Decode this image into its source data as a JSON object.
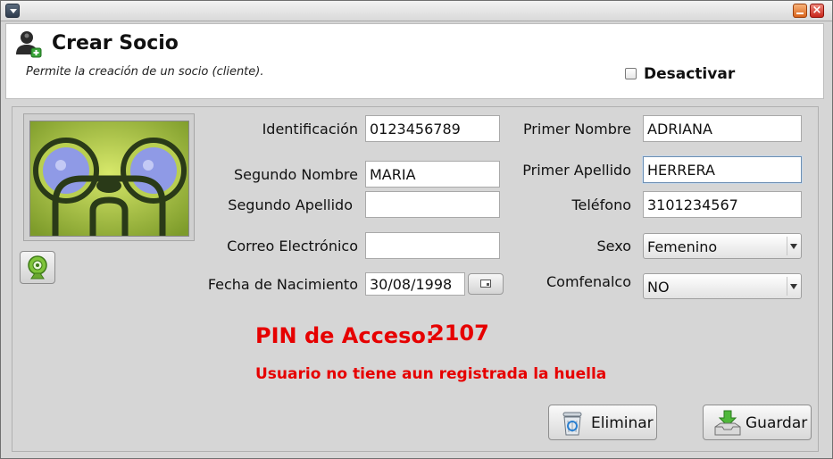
{
  "header": {
    "title": "Crear Socio",
    "subtitle": "Permite la creación de un socio (cliente).",
    "deactivate_label": "Desactivar"
  },
  "form": {
    "identificacion": {
      "label": "Identificación",
      "value": "0123456789"
    },
    "primer_nombre": {
      "label": "Primer Nombre",
      "value": "ADRIANA"
    },
    "segundo_nombre": {
      "label": "Segundo Nombre",
      "value": "MARIA"
    },
    "primer_apellido": {
      "label": "Primer Apellido",
      "value": "HERRERA"
    },
    "segundo_apellido": {
      "label": "Segundo Apellido",
      "value": ""
    },
    "telefono": {
      "label": "Teléfono",
      "value": "3101234567"
    },
    "correo": {
      "label": "Correo Electrónico",
      "value": ""
    },
    "sexo": {
      "label": "Sexo",
      "value": "Femenino"
    },
    "fecha_nacimiento": {
      "label": "Fecha de Nacimiento",
      "value": "30/08/1998"
    },
    "comfenalco": {
      "label": "Comfenalco",
      "value": "NO"
    }
  },
  "pin": {
    "label": "PIN de Acceso:",
    "value": "2107"
  },
  "warning": "Usuario no tiene aun registrada la huella",
  "actions": {
    "delete_label": "Eliminar",
    "save_label": "Guardar"
  },
  "colors": {
    "alert": "#e60000",
    "window_bg": "#d6d6d6",
    "focus_border": "#6d8fb3"
  },
  "icons": [
    "menu-icon",
    "minimize-icon",
    "close-icon",
    "user-add-icon",
    "webcam-icon",
    "calendar-icon",
    "recycle-bin-icon",
    "save-tray-icon"
  ]
}
